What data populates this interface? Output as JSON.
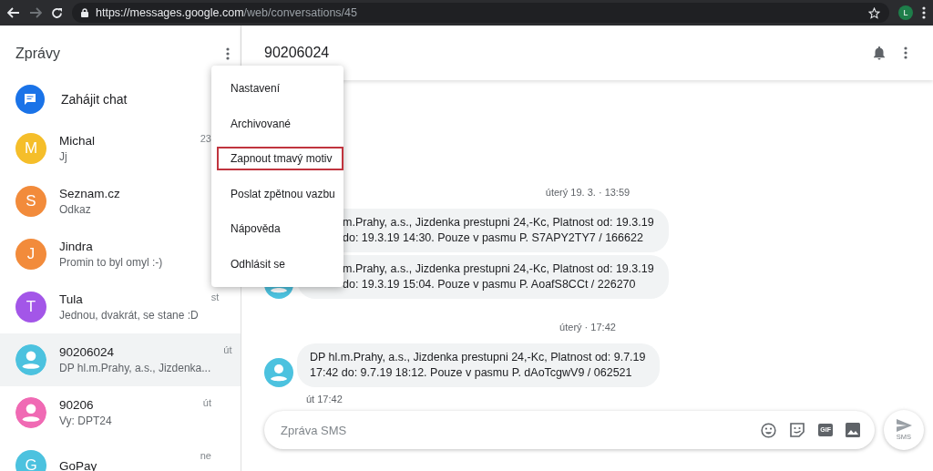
{
  "browser": {
    "url_host": "https://messages.google.com",
    "url_path": "/web/conversations/45",
    "profile": "L"
  },
  "sidebar": {
    "title": "Zprávy",
    "start_chat": "Zahájit chat",
    "conversations": [
      {
        "name": "Michal",
        "preview": "Jj",
        "time": "23",
        "kind": "letter",
        "letter": "M",
        "color": "#f5be2a",
        "selected": false
      },
      {
        "name": "Seznam.cz",
        "preview": "Odkaz",
        "kind": "letter",
        "letter": "S",
        "color": "#f28b3b",
        "selected": false
      },
      {
        "name": "Jindra",
        "preview": "Promin to byl omyl :-)",
        "kind": "letter",
        "letter": "J",
        "color": "#f28b3b",
        "selected": false
      },
      {
        "name": "Tula",
        "preview": "Jednou, dvakrát, se stane :D",
        "time": "st",
        "kind": "letter",
        "letter": "T",
        "color": "#a356e8",
        "selected": false
      },
      {
        "name": "90206024",
        "preview": "DP hl.m.Prahy, a.s., Jizdenka...",
        "time": "út",
        "kind": "person",
        "color": "#4cc2df",
        "selected": true
      },
      {
        "name": "90206",
        "preview": "Vy: DPT24",
        "time": "út",
        "kind": "person",
        "color": "#f06ab4",
        "selected": false
      },
      {
        "name": "GoPay",
        "time": "ne",
        "kind": "letter",
        "letter": "G",
        "color": "#4cc2df",
        "selected": false
      }
    ]
  },
  "menu": {
    "items": [
      {
        "label": "Nastavení",
        "outlined": false
      },
      {
        "label": "Archivované",
        "outlined": false
      },
      {
        "label": "Zapnout tmavý motiv",
        "outlined": true
      },
      {
        "label": "Poslat zpětnou vazbu",
        "outlined": false
      },
      {
        "label": "Nápověda",
        "outlined": false
      },
      {
        "label": "Odhlásit se",
        "outlined": false
      }
    ]
  },
  "conversation": {
    "title": "90206024",
    "thread": [
      {
        "kind": "separator",
        "text": "úterý 19. 3. · 13:59"
      },
      {
        "kind": "message",
        "covered": true,
        "lines": [
          "m.Prahy, a.s., Jizdenka prestupni 24,-Kc, Platnost od: 19.3.19",
          "do: 19.3.19 14:30. Pouze v pasmu P. S7APY2TY7 / 166622"
        ]
      },
      {
        "kind": "message",
        "covered": true,
        "avatar": true,
        "lines": [
          "m.Prahy, a.s., Jizdenka prestupni 24,-Kc, Platnost od: 19.3.19",
          "do: 19.3.19 15:04. Pouze v pasmu P. AoafS8CCt / 226270"
        ]
      },
      {
        "kind": "separator",
        "text": "úterý · 17:42"
      },
      {
        "kind": "message",
        "covered": false,
        "avatar": true,
        "lines": [
          "DP hl.m.Prahy, a.s., Jizdenka prestupni 24,-Kc, Platnost od: 9.7.19",
          "17:42 do: 9.7.19 18:12. Pouze v pasmu P. dAoTcgwV9 / 062521"
        ]
      },
      {
        "kind": "timestamp",
        "text": "út 17:42"
      }
    ],
    "compose": {
      "placeholder": "Zpráva SMS",
      "gif_label": "GIF",
      "send_label": "SMS"
    }
  }
}
